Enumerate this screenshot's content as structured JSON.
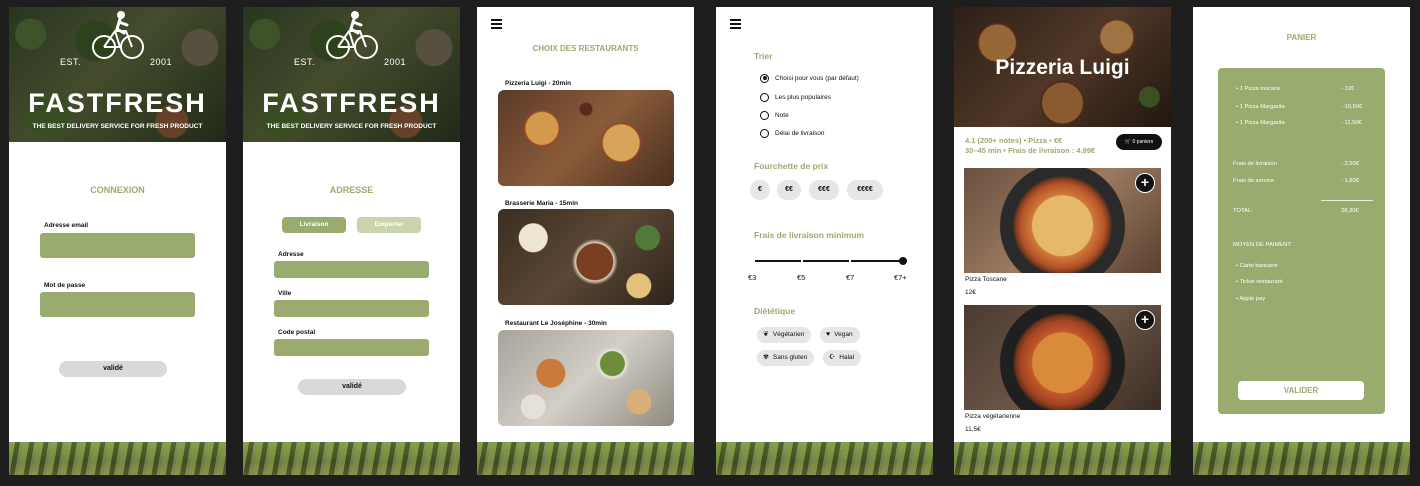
{
  "brand": {
    "est_left": "EST.",
    "est_right": "2001",
    "name": "FASTFRESH",
    "tagline": "THE BEST DELIVERY SERVICE FOR FRESH PRODUCT"
  },
  "login": {
    "title": "CONNEXION",
    "email_label": "Adresse email",
    "email_value": "",
    "password_label": "Mot de passe",
    "password_value": "",
    "submit": "validé"
  },
  "address": {
    "title": "ADRESSE",
    "toggle_delivery": "Livraison",
    "toggle_takeaway": "Emporter",
    "address_label": "Adresse",
    "city_label": "Ville",
    "postal_label": "Code postal",
    "submit": "validé"
  },
  "restaurants": {
    "title": "CHOIX DES RESTAURANTS",
    "items": [
      {
        "name": "Pizzeria Luigi - 20min"
      },
      {
        "name": "Brasserie Maria - 15min"
      },
      {
        "name": "Restaurant Le Joséphine - 30min"
      }
    ]
  },
  "filters": {
    "sort_title": "Trier",
    "sort_options": [
      {
        "label": "Choisi pour vous (par défaut)",
        "selected": true
      },
      {
        "label": "Les plus populaires",
        "selected": false
      },
      {
        "label": "Note",
        "selected": false
      },
      {
        "label": "Délai de livraison",
        "selected": false
      }
    ],
    "price_title": "Fourchette de prix",
    "price_options": [
      "€",
      "€€",
      "€€€",
      "€€€€"
    ],
    "fee_title": "Frais de livraison minimum",
    "fee_ticks": [
      "€3",
      "€5",
      "€7",
      "€7+"
    ],
    "fee_selected": "€7+",
    "diet_title": "Diététique",
    "diet_options": [
      {
        "label": "Végétarien",
        "icon": "leaf-icon",
        "glyph": "❦"
      },
      {
        "label": "Vegan",
        "icon": "heart-icon",
        "glyph": "♥"
      },
      {
        "label": "Sans gluten",
        "icon": "wheat-icon",
        "glyph": "✾"
      },
      {
        "label": "Halal",
        "icon": "halal-icon",
        "glyph": "☪"
      }
    ]
  },
  "restaurant_page": {
    "title": "Pizzeria Luigi",
    "info_line1": "4.1 (200+ notes) • Pizza • €€",
    "info_line2": "30–45 min • Frais de livraison : 4.99€",
    "cart_badge": "0 paniers",
    "dishes": [
      {
        "name": "Pizza Toscane",
        "price": "12€"
      },
      {
        "name": "Pizza végétarienne",
        "price": "11,5€"
      }
    ]
  },
  "cart": {
    "title": "PANIER",
    "items": [
      {
        "label": "1 Pizza toscane",
        "price": "- 12€"
      },
      {
        "label": "1 Pizza Margarita",
        "price": "- 10,50€"
      },
      {
        "label": "1 Pizza Margarita",
        "price": "- 11,50€"
      }
    ],
    "delivery_fee_label": "Frais de livraison",
    "delivery_fee": "- 2,50€",
    "service_fee_label": "Frais de service",
    "service_fee": "- 1,80€",
    "total_label": "TOTAL:",
    "total": "28,30€",
    "payment_title": "MOYEN DE PAIMENT:",
    "payment_methods": [
      "Carte bancaire",
      "Ticket restaurant",
      "Apple pay"
    ],
    "submit": "VALIDER"
  },
  "colors": {
    "accent": "#9aab6f",
    "background": "#1e1e1e",
    "button_grey": "#d9d9d9",
    "dark": "#111111"
  }
}
